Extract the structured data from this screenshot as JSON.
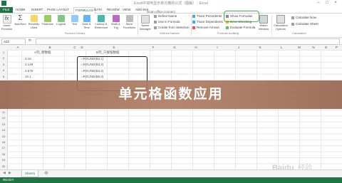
{
  "window": {
    "title": "Excel中如何显示单元格的公式（图解） - Excel"
  },
  "tabs": [
    "FILE",
    "HOME",
    "INSERT",
    "PAGE LAYOUT",
    "FORMULAS",
    "DATA",
    "REVIEW",
    "VIEW",
    "ADD-INS"
  ],
  "active_tab": "FORMULAS",
  "ribbon": {
    "function_library": {
      "label": "Function Library",
      "buttons": [
        {
          "line1": "Insert",
          "line2": "Function"
        },
        {
          "line1": "AutoSum",
          "line2": ""
        },
        {
          "line1": "Recently",
          "line2": "Used"
        },
        {
          "line1": "Financial",
          "line2": ""
        },
        {
          "line1": "Logical",
          "line2": ""
        },
        {
          "line1": "Text",
          "line2": ""
        },
        {
          "line1": "Date &",
          "line2": "Time"
        },
        {
          "line1": "Lookup &",
          "line2": "Reference"
        },
        {
          "line1": "Math &",
          "line2": "Trig"
        },
        {
          "line1": "More",
          "line2": "Functions"
        }
      ]
    },
    "defined_names": {
      "label": "Defined Names",
      "name_manager": {
        "line1": "Name",
        "line2": "Manager"
      },
      "define_name": "Define Name",
      "use_in_formula": "Use in Formula",
      "create_from_selection": "Create from Selection"
    },
    "formula_auditing": {
      "label": "Formula Auditing",
      "trace_precedents": "Trace Precedents",
      "trace_dependents": "Trace Dependents",
      "remove_arrows": "Remove Arrows",
      "show_formulas": "Show Formulas",
      "error_checking": "Error Checking",
      "evaluate_formula": "Evaluate Formula",
      "watch_window": {
        "line1": "Watch",
        "line2": "Window"
      }
    },
    "calculation": {
      "label": "Calculation",
      "options": {
        "line1": "Calculation",
        "line2": "Options"
      },
      "calc_now": "Calculate Now",
      "calc_sheet": "Calculate Sheet"
    }
  },
  "tooltip": "sinan.office.connect",
  "formula_bar": {
    "name_box": "A22",
    "fx": "fx",
    "value": ""
  },
  "columns": [
    "A",
    "B",
    "C",
    "D",
    "E",
    "F",
    "G",
    "H",
    "I",
    "J",
    "K",
    "L",
    "M",
    "N",
    "O",
    "P"
  ],
  "rows": [
    "1",
    "2",
    "3",
    "4",
    "5",
    "6",
    "7",
    "8",
    "9",
    "10",
    "11",
    "12",
    "13",
    "14",
    "15",
    "16",
    "17",
    "18",
    "19",
    "20"
  ],
  "cells": {
    "b1": "A列_原数据",
    "b2": "3.15",
    "b3": "3.149",
    "b4": "3.675",
    "b5": "10.1",
    "b6": "215.1",
    "b7": "1.06",
    "b8": "10.1",
    "e1": "B列_只保留数据",
    "e2": "=ROUND(B2,1)",
    "e3": "=ROUND(B3,2)",
    "e4": "=ROUND(B4,2)",
    "e5": "=ROUND(B5,0)",
    "e6": "=ROUND(B6,1)",
    "e7": "=ROUND(B7,1)",
    "e8": "=ROUND(B8,1)"
  },
  "banner": "单元格函数应用",
  "sheet_tab": "Sheet1",
  "status": "READY",
  "watermark": "jingyan.baidu.com",
  "colors": {
    "excel_green": "#217346",
    "highlight": "#4caf50"
  }
}
